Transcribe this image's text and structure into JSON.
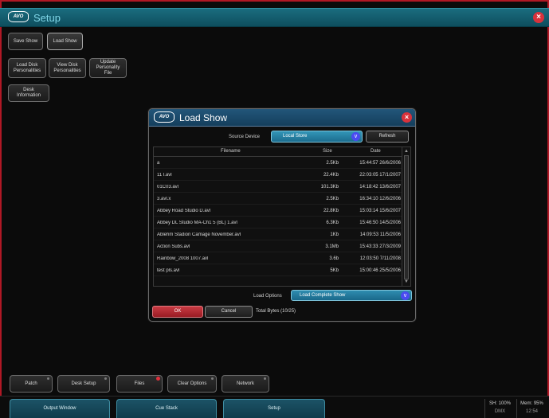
{
  "window": {
    "logo": "AVO",
    "title": "Setup",
    "close_glyph": "×"
  },
  "top_tiles": {
    "save_show": "Save Show",
    "load_show": "Load Show",
    "load_disk_personalities": "Load Disk Personalities",
    "view_disk_personalities": "View Disk Personalities",
    "update_personality_file": "Update Personality File",
    "desk_information": "Desk Information"
  },
  "dialog": {
    "logo": "AVO",
    "title": "Load Show",
    "close_glyph": "×",
    "source_device_label": "Source Device",
    "source_device_value": "Local Store",
    "refresh_label": "Refresh",
    "columns": {
      "filename": "Filename",
      "size": "Size",
      "date": "Date"
    },
    "rows": [
      {
        "name": "a",
        "size": "2.5Kb",
        "date": "15:44:57 26/6/2006"
      },
      {
        "name": "11 l.avl",
        "size": "22.4Kb",
        "date": "22:03:05 17/1/2007"
      },
      {
        "name": "01C03.avl",
        "size": "101.3Kb",
        "date": "14:18:42 13/6/2007"
      },
      {
        "name": "3.avl.x",
        "size": "2.5Kb",
        "date": "16:34:10 12/6/2006"
      },
      {
        "name": "Abbey Road Studio D.avl",
        "size": "22.8Kb",
        "date": "15:03:14 15/6/2007"
      },
      {
        "name": "Abbey DL Studio MA-Ch1 5 (BL) 1.avl",
        "size": "6.3Kb",
        "date": "15:46:50 14/5/2006"
      },
      {
        "name": "Ablehm Stadion Camage November.avl",
        "size": "1Kb",
        "date": "14:09:53 11/5/2006"
      },
      {
        "name": "Action Subs.avl",
        "size": "3.1Mb",
        "date": "15:43:33 27/3/2009"
      },
      {
        "name": "Rainbow_2008 1007.avl",
        "size": "3.6b",
        "date": "12:03:50 7/11/2008"
      },
      {
        "name": "test pls.avl",
        "size": "5Kb",
        "date": "15:00:46 25/5/2006"
      }
    ],
    "load_options_label": "Load Options",
    "load_options_value": "Load Complete Show",
    "ok_label": "OK",
    "cancel_label": "Cancel",
    "status_text": "Total Bytes (10/25)"
  },
  "bottom_tiles": {
    "patch": "Patch",
    "desk_setup": "Desk Setup",
    "files": "Files",
    "clear_options": "Clear Options",
    "network": "Network"
  },
  "bottom_tabs": {
    "output_window": "Output Window",
    "cue_stack": "Cue Stack",
    "setup": "Setup"
  },
  "status_cells": {
    "cell1_top": "SH: 100%",
    "cell1_bottom": "DMX",
    "cell2_top": "Mem: 95%",
    "cell2_bottom": "12:54"
  },
  "colors": {
    "title_bar": "#155e70",
    "dialog_title": "#1c4d6e",
    "accent_blue": "#2a86ab",
    "ok_red": "#b52a33",
    "frame_red": "#b01825"
  }
}
